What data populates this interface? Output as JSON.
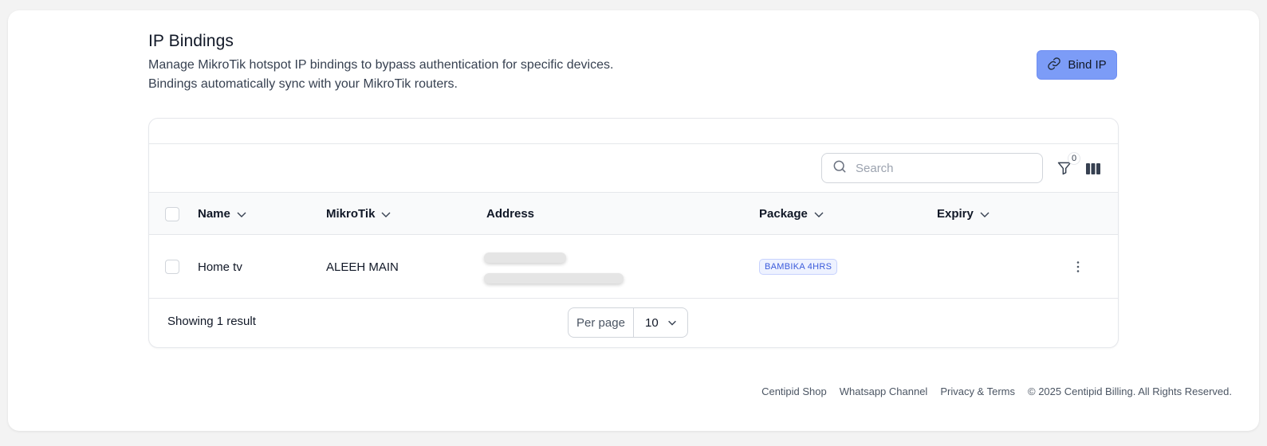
{
  "header": {
    "title": "IP Bindings",
    "subtitle_line1": "Manage MikroTik hotspot IP bindings to bypass authentication for specific devices.",
    "subtitle_line2": "Bindings automatically sync with your MikroTik routers.",
    "bind_button_label": "Bind IP"
  },
  "toolbar": {
    "search_placeholder": "Search",
    "filter_count": "0"
  },
  "table": {
    "columns": {
      "name": "Name",
      "mikrotik": "MikroTik",
      "address": "Address",
      "package": "Package",
      "expiry": "Expiry"
    },
    "rows": [
      {
        "name": "Home tv",
        "mikrotik": "ALEEH MAIN",
        "package": "BAMBIKA 4HRS",
        "expiry": ""
      }
    ],
    "footer": {
      "showing": "Showing 1 result",
      "per_page_label": "Per page",
      "per_page_value": "10"
    }
  },
  "footer": {
    "links": [
      "Centipid Shop",
      "Whatsapp Channel",
      "Privacy & Terms"
    ],
    "copyright": "© 2025 Centipid Billing. All Rights Reserved."
  },
  "colors": {
    "accent": "#7c9cf7",
    "badge_text": "#3b5bdb",
    "badge_bg": "#eef2ff"
  }
}
